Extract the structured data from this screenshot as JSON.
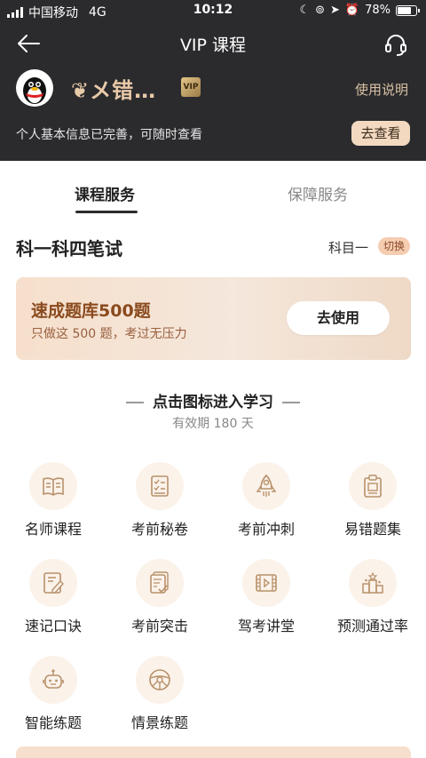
{
  "status_bar": {
    "carrier": "中国移动",
    "network": "4G",
    "time": "10:12",
    "battery": "78%",
    "battery_level": 0.78
  },
  "header": {
    "title": "VIP 课程",
    "username": "❦メ错…",
    "vip_badge": "VIP",
    "usage_link": "使用说明",
    "info_text": "个人基本信息已完善，可随时查看",
    "view_button": "去查看"
  },
  "tabs": [
    {
      "label": "课程服务",
      "active": true
    },
    {
      "label": "保障服务",
      "active": false
    }
  ],
  "subject": {
    "title": "科一科四笔试",
    "current": "科目一",
    "switch_label": "切换"
  },
  "promo": {
    "title": "速成题库500题",
    "subtitle": "只做这 500 题，考过无压力",
    "button": "去使用"
  },
  "section": {
    "heading": "点击图标进入学习",
    "validity": "有效期 180 天"
  },
  "grid": [
    {
      "label": "名师课程",
      "icon": "book-icon"
    },
    {
      "label": "考前秘卷",
      "icon": "checklist-icon"
    },
    {
      "label": "考前冲刺",
      "icon": "rocket-icon"
    },
    {
      "label": "易错题集",
      "icon": "clipboard-icon"
    },
    {
      "label": "速记口诀",
      "icon": "notepad-pen-icon"
    },
    {
      "label": "考前突击",
      "icon": "papers-check-icon"
    },
    {
      "label": "驾考讲堂",
      "icon": "video-film-icon"
    },
    {
      "label": "预测通过率",
      "icon": "podium-icon"
    },
    {
      "label": "智能练题",
      "icon": "robot-icon"
    },
    {
      "label": "情景练题",
      "icon": "steering-wheel-icon"
    }
  ],
  "colors": {
    "header_bg": "#2b2b2e",
    "accent_gold": "#c8a07a",
    "promo_text": "#8a4a1e",
    "icon_stroke": "#b8916a"
  }
}
